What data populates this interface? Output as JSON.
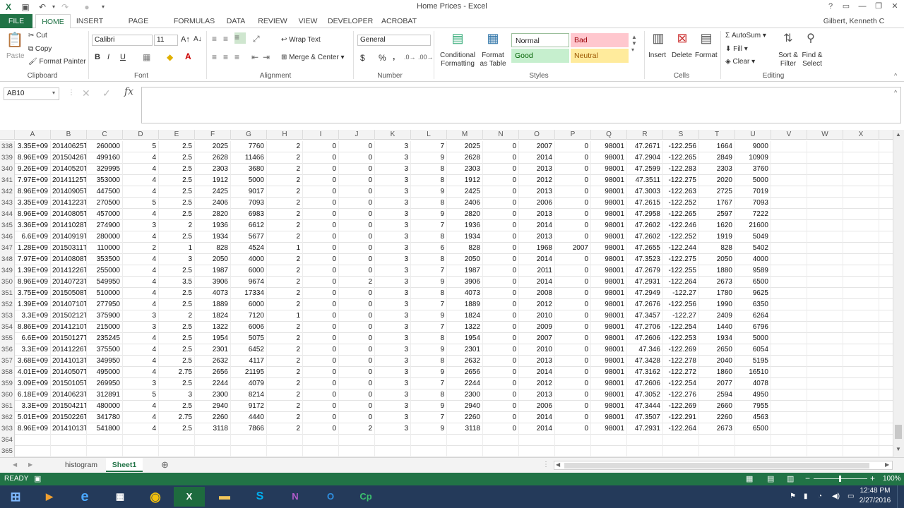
{
  "title_bar": {
    "title": "Home Prices - Excel",
    "controls": [
      "?",
      "▭",
      "—",
      "❐",
      "✕"
    ]
  },
  "ribbon_tabs": [
    "FILE",
    "HOME",
    "INSERT",
    "PAGE LAYOUT",
    "FORMULAS",
    "DATA",
    "REVIEW",
    "VIEW",
    "DEVELOPER",
    "ACROBAT"
  ],
  "active_tab": "HOME",
  "user": "Gilbert, Kenneth C",
  "clipboard": {
    "paste": "Paste",
    "cut": "Cut",
    "copy": "Copy",
    "format_painter": "Format Painter",
    "label": "Clipboard"
  },
  "font": {
    "name": "Calibri",
    "size": "11",
    "bold": "B",
    "italic": "I",
    "underline": "U",
    "label": "Font"
  },
  "alignment": {
    "wrap_text": "Wrap Text",
    "merge_center": "Merge & Center",
    "label": "Alignment"
  },
  "number": {
    "format": "General",
    "label": "Number",
    "currency": "$",
    "percent": "%",
    "comma": ","
  },
  "styles": {
    "conditional": "Conditional Formatting",
    "format_table": "Format as Table",
    "normal": "Normal",
    "bad": "Bad",
    "good": "Good",
    "neutral": "Neutral",
    "label": "Styles",
    "colors": {
      "normal": "#ffffff",
      "bad": "#ffc7ce",
      "good": "#c6efce",
      "neutral": "#ffeb9c",
      "bad_text": "#9c0006",
      "good_text": "#006100",
      "neutral_text": "#9c5700"
    }
  },
  "cells_group": {
    "insert": "Insert",
    "delete": "Delete",
    "format": "Format",
    "label": "Cells"
  },
  "editing": {
    "autosum": "AutoSum",
    "fill": "Fill",
    "clear": "Clear",
    "sort_filter": "Sort & Filter",
    "find_select": "Find & Select",
    "label": "Editing"
  },
  "name_box": "AB10",
  "formula_value": "",
  "columns": [
    "A",
    "B",
    "C",
    "D",
    "E",
    "F",
    "G",
    "H",
    "I",
    "J",
    "K",
    "L",
    "M",
    "N",
    "O",
    "P",
    "Q",
    "R",
    "S",
    "T",
    "U",
    "V",
    "W",
    "X"
  ],
  "rows": [
    {
      "n": "338",
      "v": [
        "3.35E+09",
        "20140625T",
        "260000",
        "5",
        "2.5",
        "2025",
        "7760",
        "2",
        "0",
        "0",
        "3",
        "7",
        "2025",
        "0",
        "2007",
        "0",
        "98001",
        "47.2671",
        "-122.256",
        "1664",
        "9000"
      ]
    },
    {
      "n": "339",
      "v": [
        "8.96E+09",
        "20150426T",
        "499160",
        "4",
        "2.5",
        "2628",
        "11466",
        "2",
        "0",
        "0",
        "3",
        "9",
        "2628",
        "0",
        "2014",
        "0",
        "98001",
        "47.2904",
        "-122.265",
        "2849",
        "10909"
      ]
    },
    {
      "n": "340",
      "v": [
        "9.26E+09",
        "20140520T",
        "329995",
        "4",
        "2.5",
        "2303",
        "3680",
        "2",
        "0",
        "0",
        "3",
        "8",
        "2303",
        "0",
        "2013",
        "0",
        "98001",
        "47.2599",
        "-122.283",
        "2303",
        "3760"
      ]
    },
    {
      "n": "341",
      "v": [
        "7.97E+09",
        "20141125T",
        "353000",
        "4",
        "2.5",
        "1912",
        "5000",
        "2",
        "0",
        "0",
        "3",
        "8",
        "1912",
        "0",
        "2012",
        "0",
        "98001",
        "47.3511",
        "-122.275",
        "2020",
        "5000"
      ]
    },
    {
      "n": "342",
      "v": [
        "8.96E+09",
        "20140905T",
        "447500",
        "4",
        "2.5",
        "2425",
        "9017",
        "2",
        "0",
        "0",
        "3",
        "9",
        "2425",
        "0",
        "2013",
        "0",
        "98001",
        "47.3003",
        "-122.263",
        "2725",
        "7019"
      ]
    },
    {
      "n": "343",
      "v": [
        "3.35E+09",
        "20141223T",
        "270500",
        "5",
        "2.5",
        "2406",
        "7093",
        "2",
        "0",
        "0",
        "3",
        "8",
        "2406",
        "0",
        "2006",
        "0",
        "98001",
        "47.2615",
        "-122.252",
        "1767",
        "7093"
      ]
    },
    {
      "n": "344",
      "v": [
        "8.96E+09",
        "20140805T",
        "457000",
        "4",
        "2.5",
        "2820",
        "6983",
        "2",
        "0",
        "0",
        "3",
        "9",
        "2820",
        "0",
        "2013",
        "0",
        "98001",
        "47.2958",
        "-122.265",
        "2597",
        "7222"
      ]
    },
    {
      "n": "345",
      "v": [
        "3.36E+09",
        "20141028T",
        "274900",
        "3",
        "2",
        "1936",
        "6612",
        "2",
        "0",
        "0",
        "3",
        "7",
        "1936",
        "0",
        "2014",
        "0",
        "98001",
        "47.2602",
        "-122.246",
        "1620",
        "21600"
      ]
    },
    {
      "n": "346",
      "v": [
        "6.6E+09",
        "20140919T",
        "280000",
        "4",
        "2.5",
        "1934",
        "5677",
        "2",
        "0",
        "0",
        "3",
        "8",
        "1934",
        "0",
        "2013",
        "0",
        "98001",
        "47.2602",
        "-122.252",
        "1919",
        "5049"
      ]
    },
    {
      "n": "347",
      "v": [
        "1.28E+09",
        "20150311T",
        "110000",
        "2",
        "1",
        "828",
        "4524",
        "1",
        "0",
        "0",
        "3",
        "6",
        "828",
        "0",
        "1968",
        "2007",
        "98001",
        "47.2655",
        "-122.244",
        "828",
        "5402"
      ]
    },
    {
      "n": "348",
      "v": [
        "7.97E+09",
        "20140808T",
        "353500",
        "4",
        "3",
        "2050",
        "4000",
        "2",
        "0",
        "0",
        "3",
        "8",
        "2050",
        "0",
        "2014",
        "0",
        "98001",
        "47.3523",
        "-122.275",
        "2050",
        "4000"
      ]
    },
    {
      "n": "349",
      "v": [
        "1.39E+09",
        "20141226T",
        "255000",
        "4",
        "2.5",
        "1987",
        "6000",
        "2",
        "0",
        "0",
        "3",
        "7",
        "1987",
        "0",
        "2011",
        "0",
        "98001",
        "47.2679",
        "-122.255",
        "1880",
        "9589"
      ]
    },
    {
      "n": "350",
      "v": [
        "8.96E+09",
        "20140723T",
        "549950",
        "4",
        "3.5",
        "3906",
        "9674",
        "2",
        "0",
        "2",
        "3",
        "9",
        "3906",
        "0",
        "2014",
        "0",
        "98001",
        "47.2931",
        "-122.264",
        "2673",
        "6500"
      ]
    },
    {
      "n": "351",
      "v": [
        "3.75E+09",
        "20150508T",
        "510000",
        "4",
        "2.5",
        "4073",
        "17334",
        "2",
        "0",
        "0",
        "3",
        "8",
        "4073",
        "0",
        "2008",
        "0",
        "98001",
        "47.2949",
        "-122.27",
        "1780",
        "9625"
      ]
    },
    {
      "n": "352",
      "v": [
        "1.39E+09",
        "20140710T",
        "277950",
        "4",
        "2.5",
        "1889",
        "6000",
        "2",
        "0",
        "0",
        "3",
        "7",
        "1889",
        "0",
        "2012",
        "0",
        "98001",
        "47.2676",
        "-122.256",
        "1990",
        "6350"
      ]
    },
    {
      "n": "353",
      "v": [
        "3.3E+09",
        "20150212T",
        "375900",
        "3",
        "2",
        "1824",
        "7120",
        "1",
        "0",
        "0",
        "3",
        "9",
        "1824",
        "0",
        "2010",
        "0",
        "98001",
        "47.3457",
        "-122.27",
        "2409",
        "6264"
      ]
    },
    {
      "n": "354",
      "v": [
        "8.86E+09",
        "20141210T",
        "215000",
        "3",
        "2.5",
        "1322",
        "6006",
        "2",
        "0",
        "0",
        "3",
        "7",
        "1322",
        "0",
        "2009",
        "0",
        "98001",
        "47.2706",
        "-122.254",
        "1440",
        "6796"
      ]
    },
    {
      "n": "355",
      "v": [
        "6.6E+09",
        "20150127T",
        "235245",
        "4",
        "2.5",
        "1954",
        "5075",
        "2",
        "0",
        "0",
        "3",
        "8",
        "1954",
        "0",
        "2007",
        "0",
        "98001",
        "47.2606",
        "-122.253",
        "1934",
        "5000"
      ]
    },
    {
      "n": "356",
      "v": [
        "3.3E+09",
        "20141226T",
        "375500",
        "4",
        "2.5",
        "2301",
        "6452",
        "2",
        "0",
        "0",
        "3",
        "9",
        "2301",
        "0",
        "2010",
        "0",
        "98001",
        "47.346",
        "-122.269",
        "2650",
        "6054"
      ]
    },
    {
      "n": "357",
      "v": [
        "3.68E+09",
        "20141013T",
        "349950",
        "4",
        "2.5",
        "2632",
        "4117",
        "2",
        "0",
        "0",
        "3",
        "8",
        "2632",
        "0",
        "2013",
        "0",
        "98001",
        "47.3428",
        "-122.278",
        "2040",
        "5195"
      ]
    },
    {
      "n": "358",
      "v": [
        "4.01E+09",
        "20140507T",
        "495000",
        "4",
        "2.75",
        "2656",
        "21195",
        "2",
        "0",
        "0",
        "3",
        "9",
        "2656",
        "0",
        "2014",
        "0",
        "98001",
        "47.3162",
        "-122.272",
        "1860",
        "16510"
      ]
    },
    {
      "n": "359",
      "v": [
        "3.09E+09",
        "20150105T",
        "269950",
        "3",
        "2.5",
        "2244",
        "4079",
        "2",
        "0",
        "0",
        "3",
        "7",
        "2244",
        "0",
        "2012",
        "0",
        "98001",
        "47.2606",
        "-122.254",
        "2077",
        "4078"
      ]
    },
    {
      "n": "360",
      "v": [
        "6.18E+09",
        "20140623T",
        "312891",
        "5",
        "3",
        "2300",
        "8214",
        "2",
        "0",
        "0",
        "3",
        "8",
        "2300",
        "0",
        "2013",
        "0",
        "98001",
        "47.3052",
        "-122.276",
        "2594",
        "4950"
      ]
    },
    {
      "n": "361",
      "v": [
        "3.3E+09",
        "20150421T",
        "480000",
        "4",
        "2.5",
        "2940",
        "9172",
        "2",
        "0",
        "0",
        "3",
        "9",
        "2940",
        "0",
        "2006",
        "0",
        "98001",
        "47.3444",
        "-122.269",
        "2660",
        "7955"
      ]
    },
    {
      "n": "362",
      "v": [
        "5.01E+09",
        "20150226T",
        "341780",
        "4",
        "2.75",
        "2260",
        "4440",
        "2",
        "0",
        "0",
        "3",
        "7",
        "2260",
        "0",
        "2014",
        "0",
        "98001",
        "47.3507",
        "-122.291",
        "2260",
        "4563"
      ]
    },
    {
      "n": "363",
      "v": [
        "8.96E+09",
        "20141013T",
        "541800",
        "4",
        "2.5",
        "3118",
        "7866",
        "2",
        "0",
        "2",
        "3",
        "9",
        "3118",
        "0",
        "2014",
        "0",
        "98001",
        "47.2931",
        "-122.264",
        "2673",
        "6500"
      ]
    },
    {
      "n": "364",
      "v": []
    },
    {
      "n": "365",
      "v": []
    }
  ],
  "sheets": [
    "histogram",
    "Sheet1"
  ],
  "active_sheet": "Sheet1",
  "status": {
    "ready": "READY",
    "zoom": "100%"
  },
  "taskbar": {
    "clock_time": "12:48 PM",
    "clock_date": "2/27/2016",
    "apps": [
      "start",
      "media",
      "ie",
      "calculator",
      "chrome",
      "excel",
      "explorer",
      "skype",
      "onenote",
      "outlook",
      "captivate"
    ]
  },
  "colors": {
    "excel_green": "#217346",
    "taskbar": "#243a5a"
  }
}
